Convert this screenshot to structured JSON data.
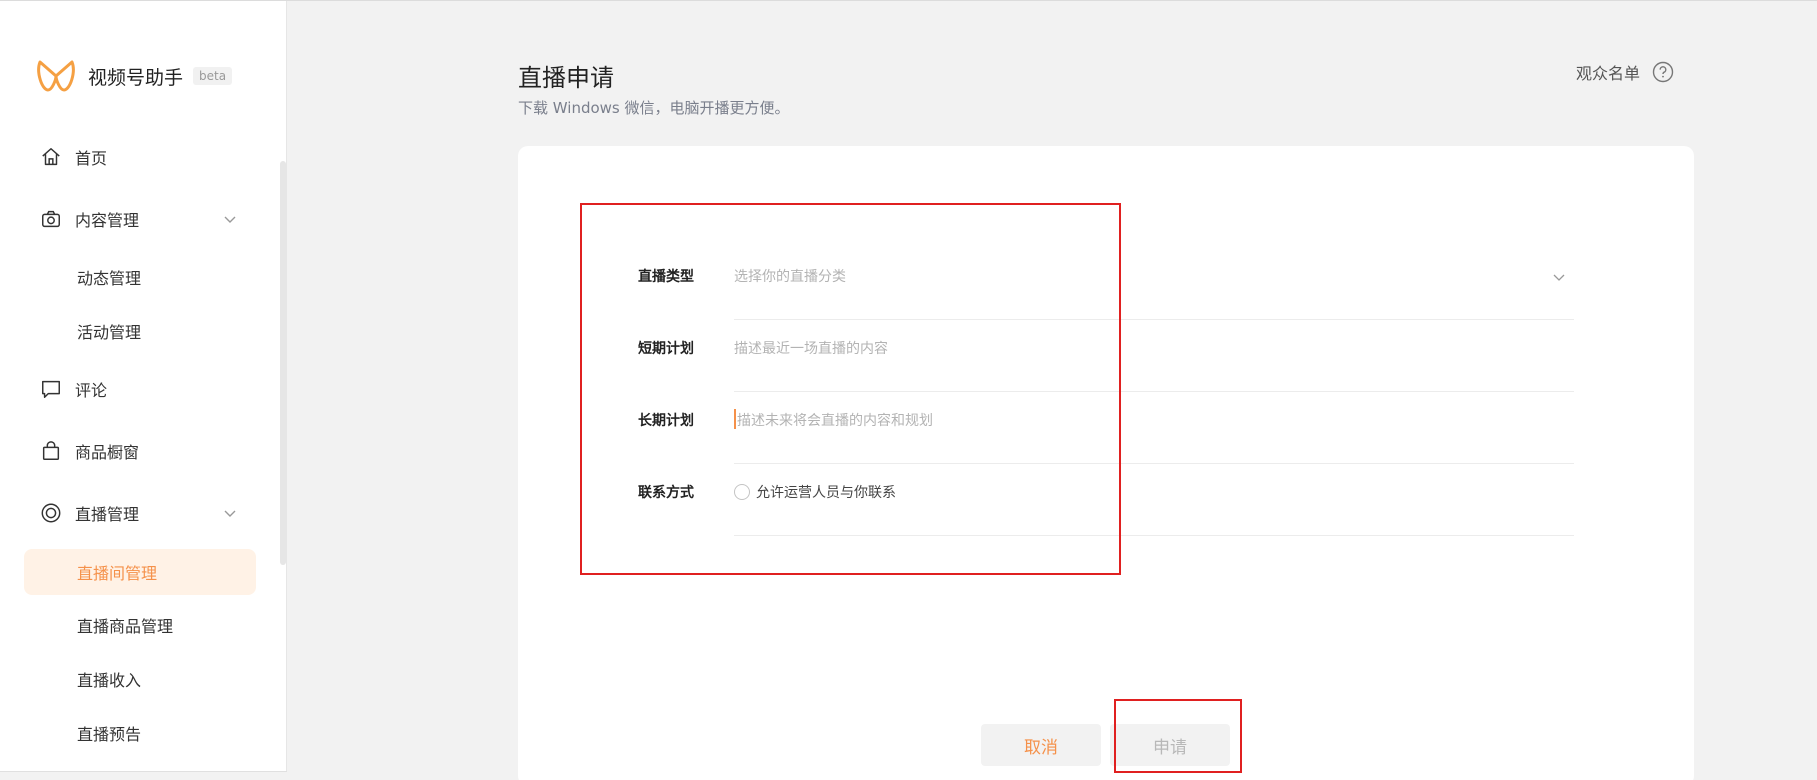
{
  "sidebar": {
    "brand_name": "视频号助手",
    "brand_badge": "beta",
    "items": [
      {
        "label": "首页",
        "icon": "home-icon"
      },
      {
        "label": "内容管理",
        "icon": "camera-icon"
      },
      {
        "label": "动态管理"
      },
      {
        "label": "活动管理"
      },
      {
        "label": "评论",
        "icon": "comment-icon"
      },
      {
        "label": "商品橱窗",
        "icon": "bag-icon"
      },
      {
        "label": "直播管理",
        "icon": "live-icon"
      },
      {
        "label": "直播间管理",
        "active": true
      },
      {
        "label": "直播商品管理"
      },
      {
        "label": "直播收入"
      },
      {
        "label": "直播预告"
      }
    ]
  },
  "header": {
    "title": "直播申请",
    "subtitle": "下载 Windows 微信，电脑开播更方便。",
    "audience_link": "观众名单"
  },
  "form": {
    "type_label": "直播类型",
    "type_placeholder": "选择你的直播分类",
    "short_label": "短期计划",
    "short_placeholder": "描述最近一场直播的内容",
    "long_label": "长期计划",
    "long_placeholder": "描述未来将会直播的内容和规划",
    "contact_label": "联系方式",
    "contact_option": "允许运营人员与你联系"
  },
  "actions": {
    "cancel": "取消",
    "apply": "申请"
  },
  "colors": {
    "accent": "#f5914a",
    "annotation": "#e02020"
  }
}
